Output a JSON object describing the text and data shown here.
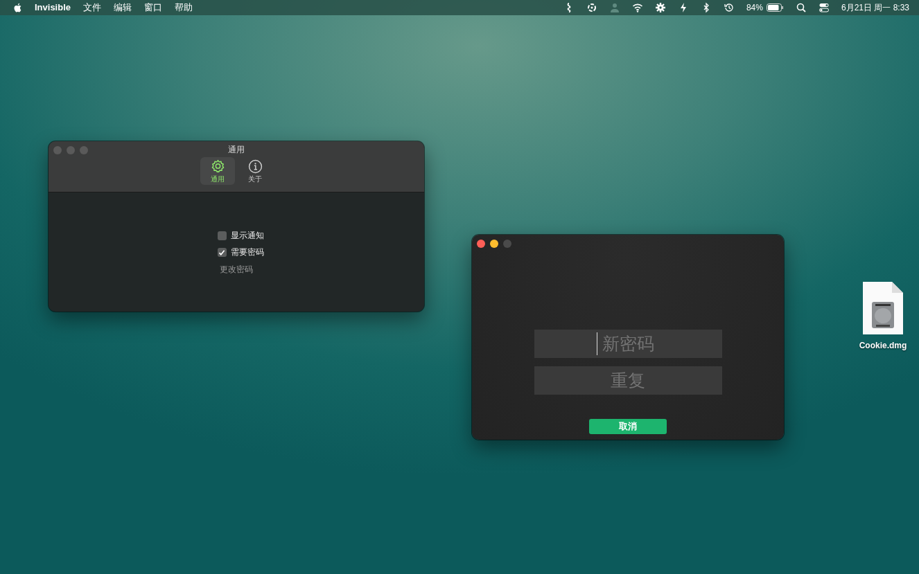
{
  "menu_bar": {
    "app_name": "Invisible",
    "menus": [
      "文件",
      "编辑",
      "窗口",
      "帮助"
    ],
    "battery": "84%",
    "clock": "6月21日 周一 8:33"
  },
  "settings_window": {
    "title": "通用",
    "active": false,
    "tabs": [
      {
        "label": "通用",
        "kind": "gear",
        "selected": true
      },
      {
        "label": "关于",
        "kind": "info",
        "selected": false
      }
    ],
    "options": [
      {
        "label": "显示通知",
        "checked": false
      },
      {
        "label": "需要密码",
        "checked": true
      }
    ],
    "link": "更改密码"
  },
  "password_window": {
    "active": true,
    "fields": [
      {
        "placeholder": "新密码",
        "focused": true
      },
      {
        "placeholder": "重复",
        "focused": false
      }
    ],
    "button": "取消"
  },
  "desktop_icons": [
    {
      "label": "Cookie.dmg"
    }
  ]
}
